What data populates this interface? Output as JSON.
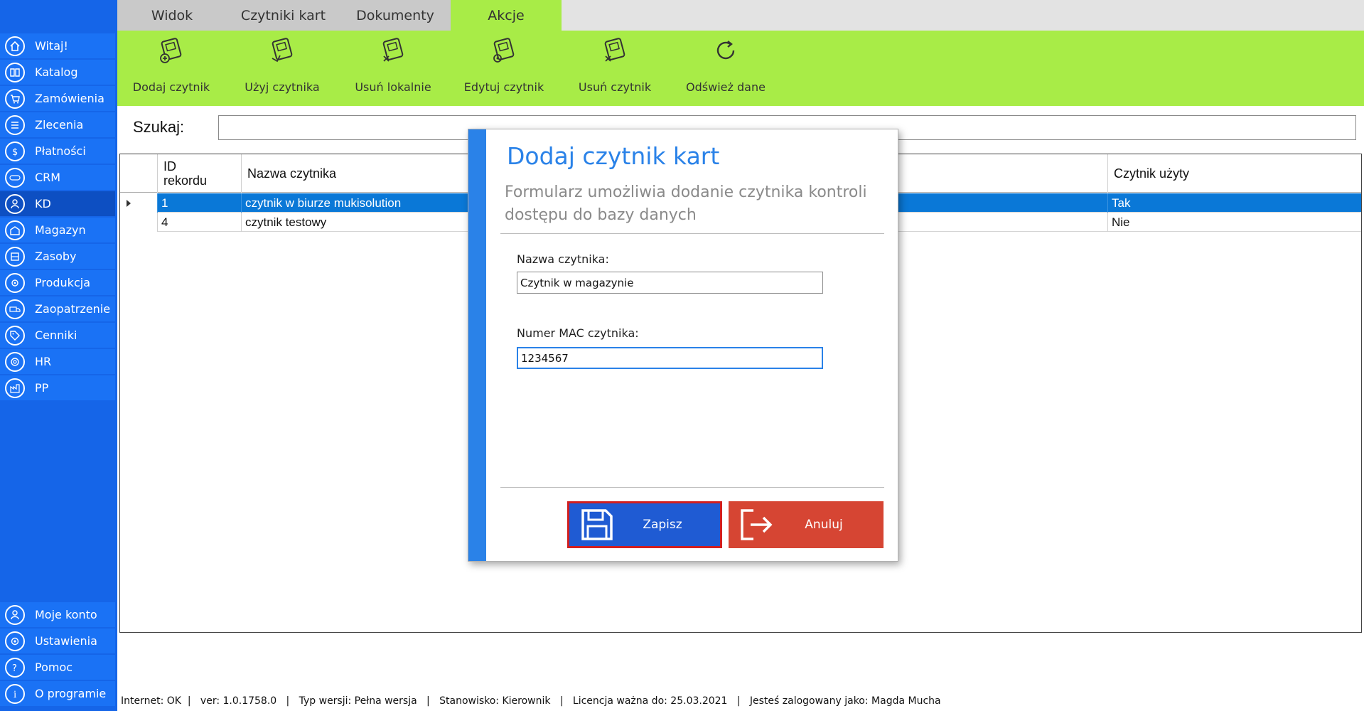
{
  "sidebar": {
    "items": [
      {
        "label": "Witaj!",
        "icon": "home-icon"
      },
      {
        "label": "Katalog",
        "icon": "book-icon"
      },
      {
        "label": "Zamówienia",
        "icon": "cart-icon"
      },
      {
        "label": "Zlecenia",
        "icon": "list-icon"
      },
      {
        "label": "Płatności",
        "icon": "dollar-icon"
      },
      {
        "label": "CRM",
        "icon": "crm-icon"
      },
      {
        "label": "KD",
        "icon": "person-icon"
      },
      {
        "label": "Magazyn",
        "icon": "warehouse-icon"
      },
      {
        "label": "Zasoby",
        "icon": "resources-icon"
      },
      {
        "label": "Produkcja",
        "icon": "production-icon"
      },
      {
        "label": "Zaopatrzenie",
        "icon": "truck-icon"
      },
      {
        "label": "Cenniki",
        "icon": "tag-icon"
      },
      {
        "label": "HR",
        "icon": "hr-icon"
      },
      {
        "label": "PP",
        "icon": "pp-icon"
      }
    ],
    "bottom_items": [
      {
        "label": "Moje konto",
        "icon": "account-icon"
      },
      {
        "label": "Ustawienia",
        "icon": "settings-icon"
      },
      {
        "label": "Pomoc",
        "icon": "help-icon"
      },
      {
        "label": "O programie",
        "icon": "info-icon"
      }
    ],
    "active": "KD",
    "color": "#1565e8"
  },
  "tabs": [
    {
      "label": "Widok"
    },
    {
      "label": "Czytniki kart"
    },
    {
      "label": "Dokumenty"
    },
    {
      "label": "Akcje"
    }
  ],
  "active_tab": "Akcje",
  "ribbon": {
    "color": "#a8ec47",
    "buttons": [
      {
        "label": "Dodaj czytnik"
      },
      {
        "label": "Użyj czytnika"
      },
      {
        "label": "Usuń lokalnie"
      },
      {
        "label": "Edytuj czytnik"
      },
      {
        "label": "Usuń czytnik"
      },
      {
        "label": "Odśwież dane"
      }
    ]
  },
  "search": {
    "label": "Szukaj:",
    "value": ""
  },
  "grid": {
    "columns": [
      "ID\nrekordu",
      "Nazwa czytnika",
      "Czytnik użyty"
    ],
    "rows": [
      {
        "id": "1",
        "name": "czytnik w biurze mukisolution",
        "used": "Tak",
        "selected": true
      },
      {
        "id": "4",
        "name": "czytnik testowy",
        "used": "Nie",
        "selected": false
      }
    ]
  },
  "dialog": {
    "title": "Dodaj czytnik kart",
    "subtitle": "Formularz umożliwia dodanie czytnika kontroli dostępu do bazy danych",
    "name_label": "Nazwa czytnika:",
    "name_value": "Czytnik w magazynie",
    "mac_label": "Numer MAC czytnika:",
    "mac_value": "1234567",
    "save_label": "Zapisz",
    "cancel_label": "Anuluj",
    "accent": "#2a82e8",
    "save_color": "#1f5bd3",
    "cancel_color": "#d64533"
  },
  "status": {
    "text": "Internet: OK  |   ver: 1.0.1758.0   |   Typ wersji: Pełna wersja   |   Stanowisko: Kierownik   |   Licencja ważna do: 25.03.2021   |   Jesteś zalogowany jako: Magda Mucha"
  }
}
